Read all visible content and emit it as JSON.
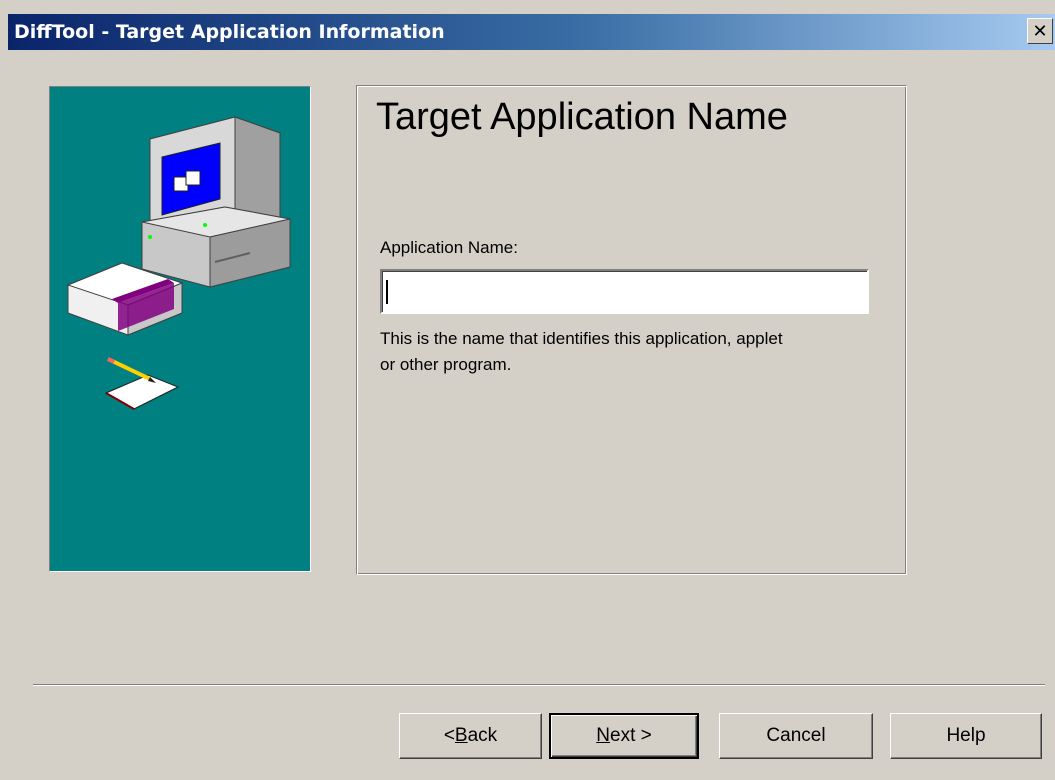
{
  "window": {
    "title": "DiffTool - Target Application Information",
    "close_glyph": "✕"
  },
  "illustration": {
    "icon": "computer-disk-notepad-illustration",
    "background_color": "#008080"
  },
  "panel": {
    "title": "Target Application Name",
    "field_label": "Application Name:",
    "field_value": "",
    "help_text": "This is the name that identifies this application, applet or other program."
  },
  "buttons": {
    "back": {
      "prefix": "< ",
      "mnemonic": "B",
      "rest": "ack"
    },
    "next": {
      "mnemonic": "N",
      "rest": "ext >"
    },
    "cancel": "Cancel",
    "help": "Help"
  },
  "colors": {
    "title_gradient_start": "#0a246a",
    "title_gradient_end": "#a6caf0",
    "face": "#d4d0c8"
  }
}
